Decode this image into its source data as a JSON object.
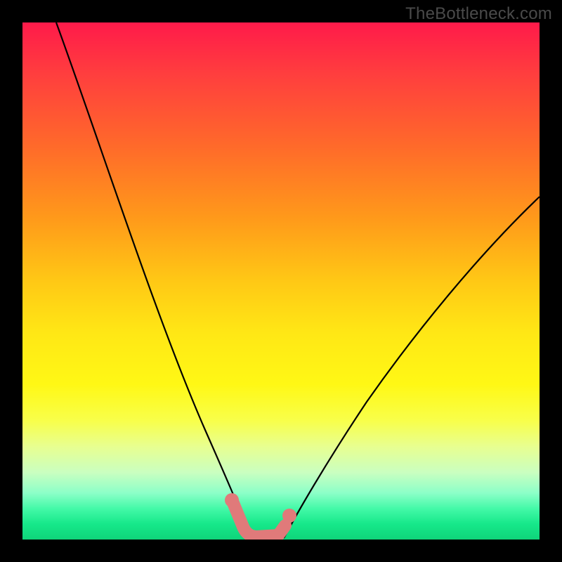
{
  "watermark": "TheBottleneck.com",
  "colors": {
    "background": "#000000",
    "curve": "#000000",
    "marker": "#e07a7a"
  },
  "chart_data": {
    "type": "line",
    "title": "",
    "xlabel": "",
    "ylabel": "",
    "xlim": [
      0,
      100
    ],
    "ylim": [
      0,
      100
    ],
    "grid": false,
    "legend": false,
    "background_gradient": [
      "#ff1a4a",
      "#ffe715",
      "#0fd47a"
    ],
    "series": [
      {
        "name": "left-curve",
        "x": [
          5,
          10,
          15,
          20,
          25,
          30,
          35,
          38,
          40,
          42,
          43
        ],
        "y": [
          100,
          85,
          70,
          56,
          43,
          30,
          18,
          10,
          5,
          2,
          0
        ]
      },
      {
        "name": "right-curve",
        "x": [
          50,
          52,
          55,
          60,
          65,
          70,
          75,
          80,
          85,
          90,
          95,
          100
        ],
        "y": [
          0,
          3,
          8,
          17,
          25,
          32,
          39,
          45,
          51,
          56,
          61,
          66
        ]
      },
      {
        "name": "valley-marker",
        "x": [
          40,
          43,
          46,
          49,
          51
        ],
        "y": [
          6,
          1,
          0,
          0,
          4
        ]
      }
    ],
    "annotations": []
  }
}
